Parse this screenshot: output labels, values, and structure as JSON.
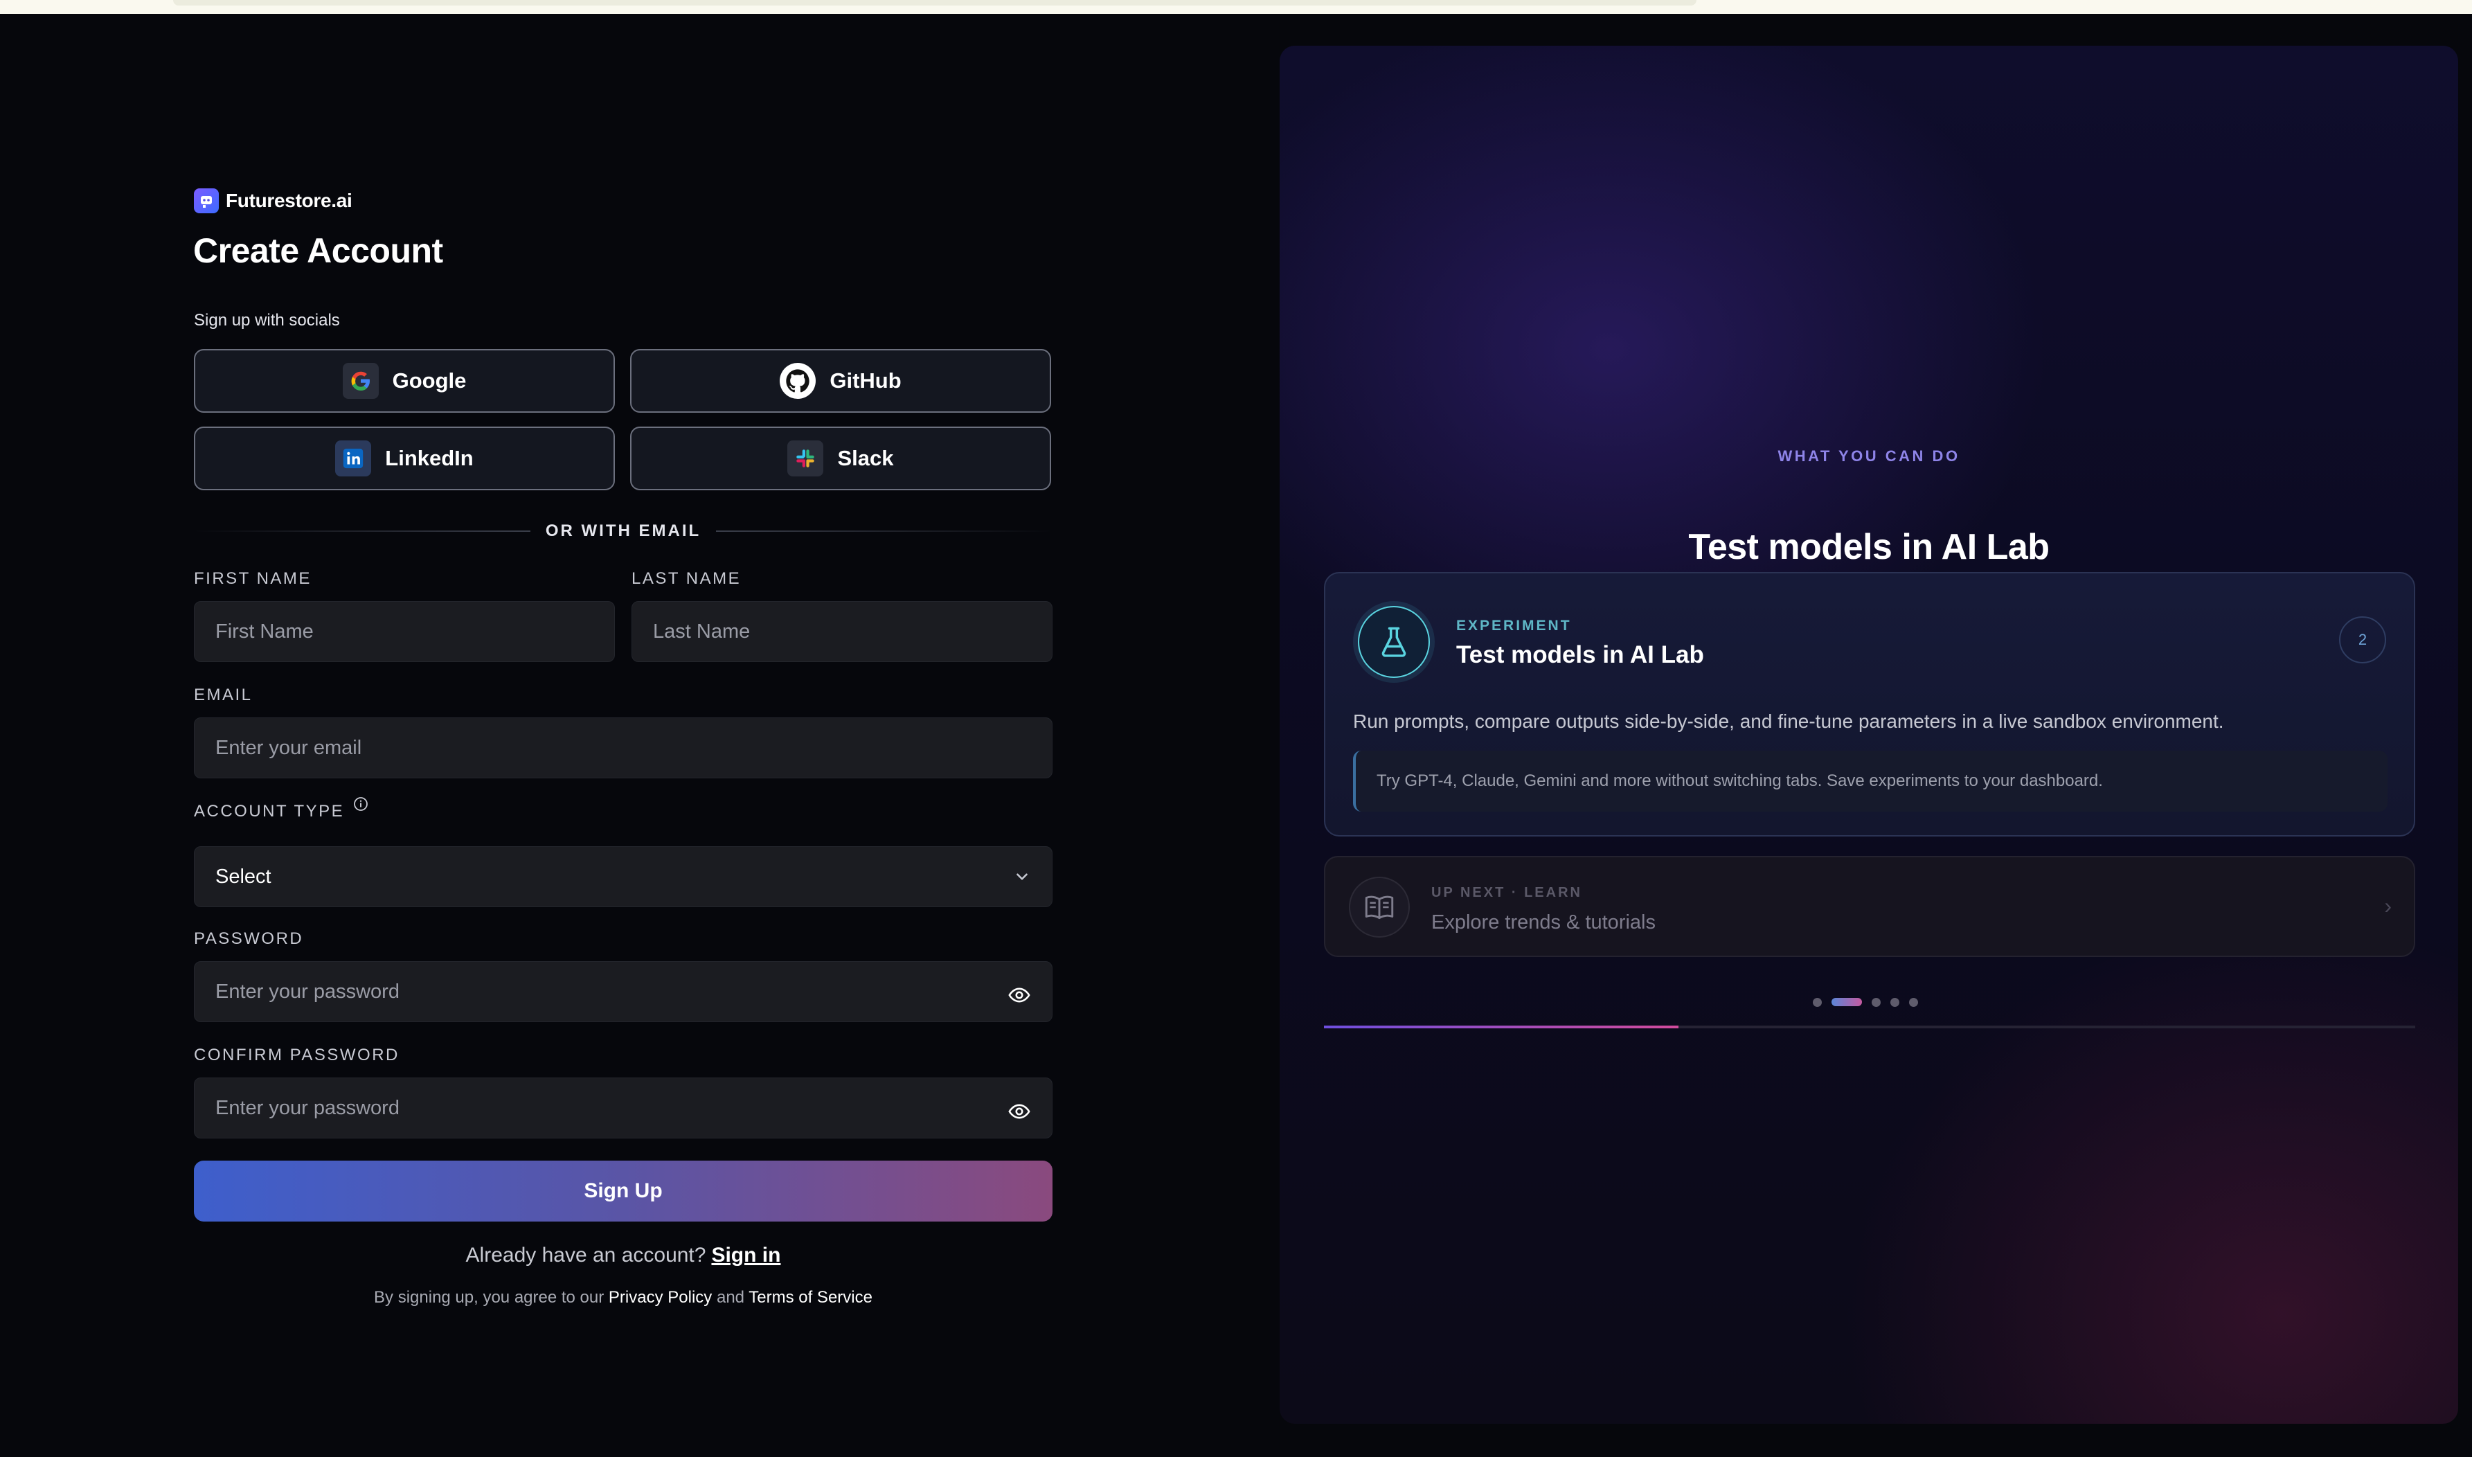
{
  "brand": {
    "name": "Futurestore.ai"
  },
  "form": {
    "title": "Create Account",
    "social_label": "Sign up with socials",
    "socials": [
      {
        "label": "Google",
        "icon": "google-icon"
      },
      {
        "label": "GitHub",
        "icon": "github-icon"
      },
      {
        "label": "LinkedIn",
        "icon": "linkedin-icon"
      },
      {
        "label": "Slack",
        "icon": "slack-icon"
      }
    ],
    "divider": "OR WITH EMAIL",
    "first_name": {
      "label": "FIRST NAME",
      "placeholder": "First Name"
    },
    "last_name": {
      "label": "LAST NAME",
      "placeholder": "Last Name"
    },
    "email": {
      "label": "EMAIL",
      "placeholder": "Enter your email"
    },
    "account_type": {
      "label": "ACCOUNT TYPE",
      "value": "Select"
    },
    "password": {
      "label": "PASSWORD",
      "placeholder": "Enter your password"
    },
    "confirm_password": {
      "label": "CONFIRM PASSWORD",
      "placeholder": "Enter your password"
    },
    "submit": "Sign Up",
    "already": "Already have an account?",
    "signin": "Sign in",
    "terms_prefix": "By signing up, you agree to our",
    "privacy": "Privacy Policy",
    "and": "and",
    "tos": "Terms of Service"
  },
  "panel": {
    "eyebrow": "WHAT YOU CAN DO",
    "title": "Test models in AI Lab",
    "card": {
      "kicker": "EXPERIMENT",
      "title": "Test models in AI Lab",
      "badge": "2",
      "description": "Run prompts, compare outputs side-by-side, and fine-tune parameters in a live sandbox environment.",
      "hint": "Try GPT-4, Claude, Gemini and more without switching tabs. Save experiments to your dashboard."
    },
    "next": {
      "kicker": "UP NEXT · LEARN",
      "title": "Explore trends & tutorials",
      "chevron": "›"
    },
    "carousel": {
      "slides": 5,
      "active": 2,
      "progress": 0.325
    }
  },
  "colors": {
    "accent_gradient_start": "#3e5fcc",
    "accent_gradient_end": "#8a4a7e",
    "panel_eyebrow": "#8e84e8"
  }
}
